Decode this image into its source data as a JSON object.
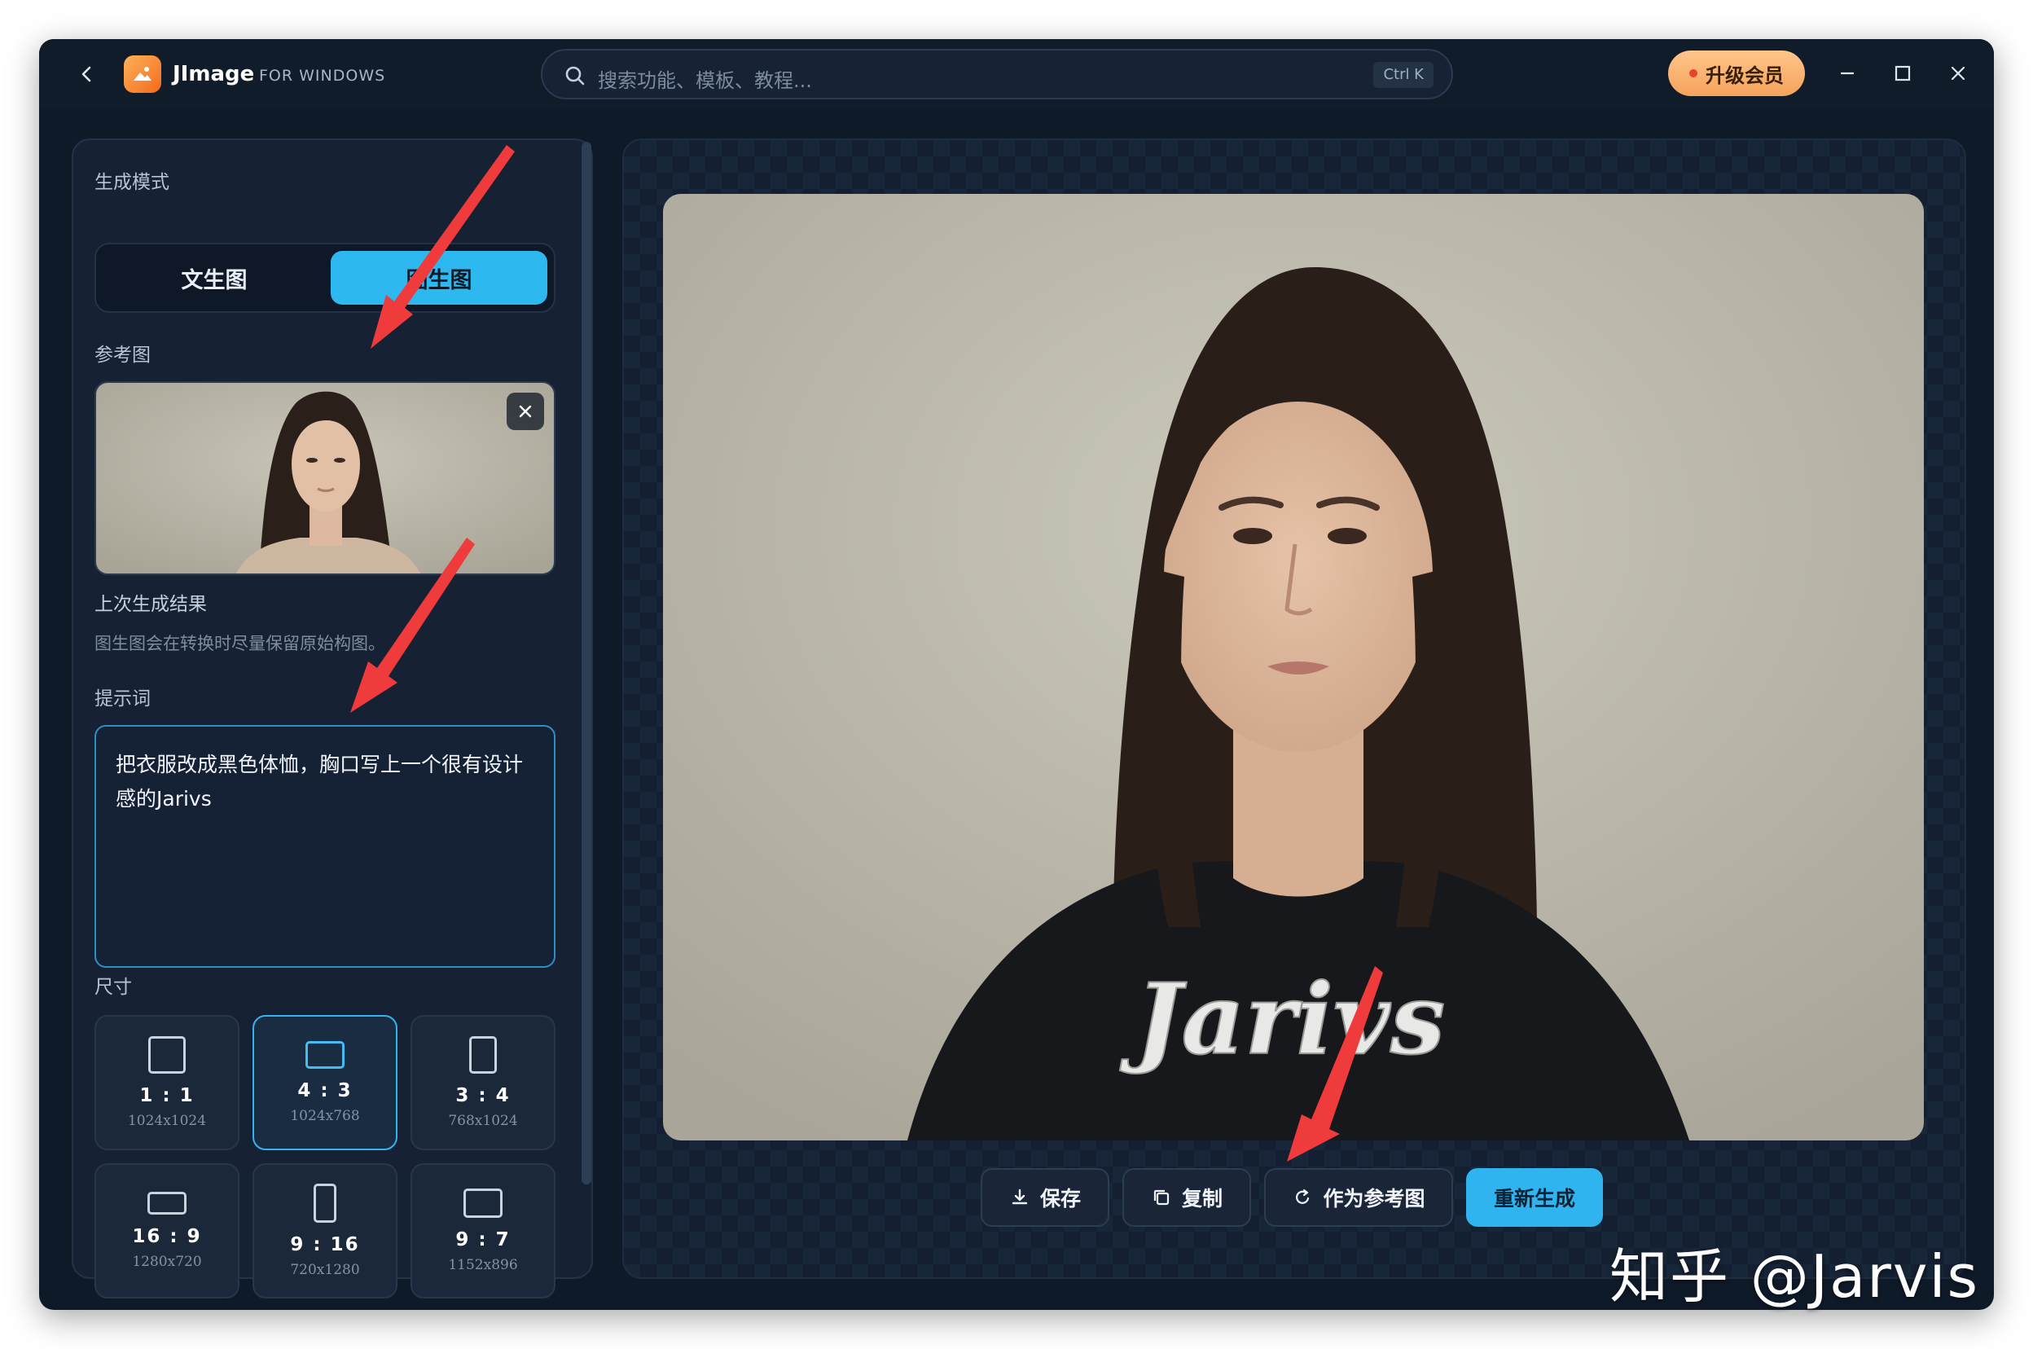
{
  "app": {
    "name": "JImage",
    "subtitle": "FOR WINDOWS",
    "colors": {
      "accent": "#2db8f0",
      "window_bg": "#0f1a29",
      "upgrade": "#f5a35c"
    }
  },
  "search": {
    "placeholder": "搜索功能、模板、教程...",
    "shortcut": "Ctrl K",
    "icon": "search-icon"
  },
  "header": {
    "upgrade_label": "升级会员"
  },
  "left": {
    "mode_label": "生成模式",
    "modes": [
      {
        "label": "文生图",
        "selected": false
      },
      {
        "label": "图生图",
        "selected": true
      }
    ],
    "reference_label": "参考图",
    "last_result_label": "上次生成结果",
    "hint": "图生图会在转换时尽量保留原始构图。",
    "prompt_label": "提示词",
    "prompt_value": "把衣服改成黑色体恤，胸口写上一个很有设计感的Jarivs",
    "size_label": "尺寸",
    "sizes": [
      {
        "ratio": "1 : 1",
        "res": "1024x1024",
        "selected": false
      },
      {
        "ratio": "4 : 3",
        "res": "1024x768",
        "selected": true
      },
      {
        "ratio": "3 : 4",
        "res": "768x1024",
        "selected": false
      },
      {
        "ratio": "16 : 9",
        "res": "1280x720",
        "selected": false
      },
      {
        "ratio": "9 : 16",
        "res": "720x1280",
        "selected": false
      },
      {
        "ratio": "9 : 7",
        "res": "1152x896",
        "selected": false
      }
    ]
  },
  "image_text": "Jarivs",
  "actions": {
    "save": "保存",
    "copy": "复制",
    "use_as_reference": "作为参考图",
    "regenerate": "重新生成"
  },
  "watermark": "知乎 @Jarvis"
}
